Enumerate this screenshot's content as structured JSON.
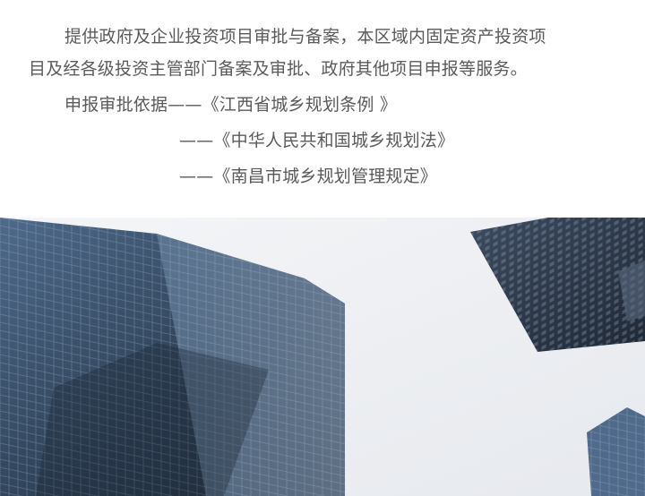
{
  "intro": {
    "line1": "提供政府及企业投资项目审批与备案，本区域内固定资产投资项",
    "line2": "目及经各级投资主管部门备案及审批、政府其他项目申报等服务。"
  },
  "basis": {
    "heading": "申报审批依据——《江西省城乡规划条例 》",
    "ref2": "——《中华人民共和国城乡规划法》",
    "ref3": "——《南昌市城乡规划管理规定》"
  },
  "image": {
    "subject": "skyscrapers-from-below",
    "sky_color": "#eef0f3",
    "glass_color": "#3f5671"
  }
}
